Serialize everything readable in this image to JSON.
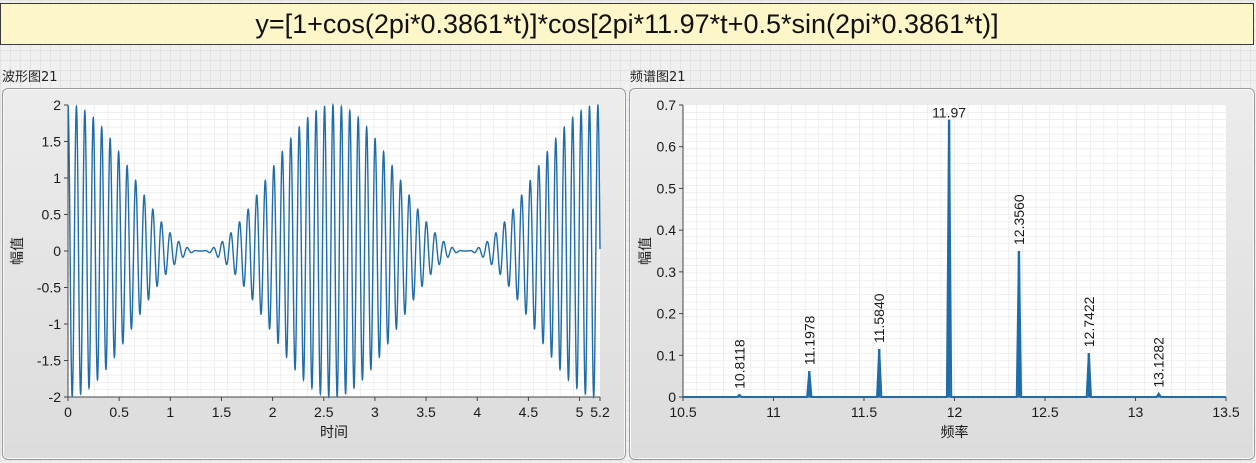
{
  "formula": "y=[1+cos(2pi*0.3861*t)]*cos[2pi*11.97*t+0.5*sin(2pi*0.3861*t)]",
  "colors": {
    "trace": "#1f6ca8",
    "plot_bg": "#ffffff",
    "grid": "#e6e6e6"
  },
  "chart_data": [
    {
      "type": "line",
      "panel_label": "波形图21",
      "xlabel": "时间",
      "ylabel": "幅值",
      "xlim": [
        0,
        5.2
      ],
      "ylim": [
        -2,
        2
      ],
      "x_ticks": [
        "0",
        "0.5",
        "1",
        "1.5",
        "2",
        "2.5",
        "3",
        "3.5",
        "4",
        "4.5",
        "5",
        "5.2"
      ],
      "y_ticks": [
        "2",
        "1.5",
        "1",
        "0.5",
        "0",
        "-0.5",
        "-1",
        "-1.5",
        "-2"
      ],
      "signal": {
        "carrier_hz": 11.97,
        "modulation_hz": 0.3861,
        "am_depth": 1,
        "fm_index": 0.5
      },
      "grid": true
    },
    {
      "type": "line",
      "panel_label": "频谱图21",
      "xlabel": "频率",
      "ylabel": "幅值",
      "xlim": [
        10.5,
        13.5
      ],
      "ylim": [
        0,
        0.7
      ],
      "x_ticks": [
        "10.5",
        "11",
        "11.5",
        "12",
        "12.5",
        "13",
        "13.5"
      ],
      "y_ticks": [
        "0.7",
        "0.6",
        "0.5",
        "0.4",
        "0.3",
        "0.2",
        "0.1",
        "0"
      ],
      "peaks": [
        {
          "label": "10.8118",
          "x": 10.8118,
          "y": 0.005
        },
        {
          "label": "11.1978",
          "x": 11.1978,
          "y": 0.062
        },
        {
          "label": "11.5840",
          "x": 11.584,
          "y": 0.115
        },
        {
          "label": "11.97",
          "x": 11.97,
          "y": 0.665
        },
        {
          "label": "12.3560",
          "x": 12.356,
          "y": 0.35
        },
        {
          "label": "12.7422",
          "x": 12.7422,
          "y": 0.105
        },
        {
          "label": "13.1282",
          "x": 13.1282,
          "y": 0.008
        }
      ],
      "grid": true
    }
  ]
}
